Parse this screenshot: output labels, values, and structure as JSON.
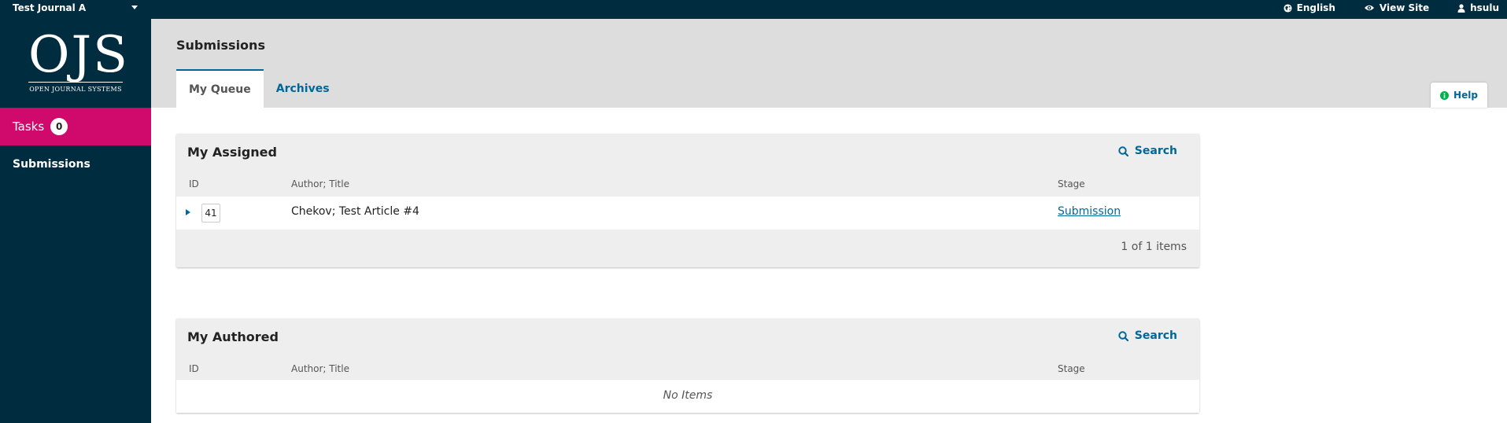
{
  "topbar": {
    "journal_name": "Test Journal A",
    "language_label": "English",
    "view_site_label": "View Site",
    "username": "hsulu"
  },
  "sidebar": {
    "logo_mark": "OJS",
    "logo_subtitle": "OPEN JOURNAL SYSTEMS",
    "tasks_label": "Tasks",
    "tasks_count": "0",
    "submissions_label": "Submissions"
  },
  "header": {
    "title": "Submissions",
    "tabs": [
      {
        "label": "My Queue"
      },
      {
        "label": "Archives"
      }
    ],
    "help_label": "Help"
  },
  "panels": {
    "assigned": {
      "title": "My Assigned",
      "search_label": "Search",
      "columns": {
        "id": "ID",
        "author_title": "Author; Title",
        "stage": "Stage"
      },
      "rows": [
        {
          "id": "41",
          "author_title": "Chekov; Test Article #4",
          "stage": "Submission"
        }
      ],
      "pager": "1 of 1 items"
    },
    "authored": {
      "title": "My Authored",
      "search_label": "Search",
      "columns": {
        "id": "ID",
        "author_title": "Author; Title",
        "stage": "Stage"
      },
      "empty_text": "No Items"
    }
  },
  "colors": {
    "topbar_bg": "#002c40",
    "accent": "#006798",
    "tasks_bg": "#d00a6c",
    "header_bg": "#dddddd",
    "help_icon": "#00b24e"
  }
}
